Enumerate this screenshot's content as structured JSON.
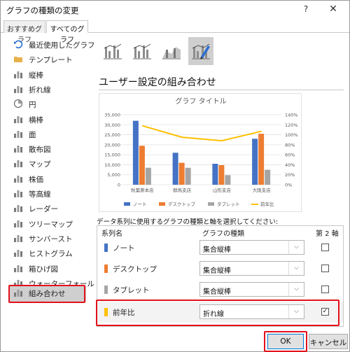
{
  "window": {
    "title": "グラフの種類の変更",
    "help_label": "?",
    "close_label": "✕"
  },
  "tabs": [
    {
      "label": "おすすめグラフ",
      "selected": false
    },
    {
      "label": "すべてのグラフ",
      "selected": true
    }
  ],
  "sidebar": {
    "items": [
      {
        "label": "最近使用したグラフ",
        "icon": "undo-icon"
      },
      {
        "label": "テンプレート",
        "icon": "folder-icon"
      },
      {
        "label": "縦棒",
        "icon": "column-chart-icon"
      },
      {
        "label": "折れ線",
        "icon": "line-chart-icon"
      },
      {
        "label": "円",
        "icon": "pie-chart-icon"
      },
      {
        "label": "横棒",
        "icon": "bar-chart-icon"
      },
      {
        "label": "面",
        "icon": "area-chart-icon"
      },
      {
        "label": "散布図",
        "icon": "scatter-chart-icon"
      },
      {
        "label": "マップ",
        "icon": "map-chart-icon"
      },
      {
        "label": "株価",
        "icon": "stock-chart-icon"
      },
      {
        "label": "等高線",
        "icon": "surface-chart-icon"
      },
      {
        "label": "レーダー",
        "icon": "radar-chart-icon"
      },
      {
        "label": "ツリーマップ",
        "icon": "treemap-chart-icon"
      },
      {
        "label": "サンバースト",
        "icon": "sunburst-chart-icon"
      },
      {
        "label": "ヒストグラム",
        "icon": "histogram-chart-icon"
      },
      {
        "label": "箱ひげ図",
        "icon": "box-whisker-chart-icon"
      },
      {
        "label": "ウォーターフォール",
        "icon": "waterfall-chart-icon"
      },
      {
        "label": "じょうご",
        "icon": "funnel-chart-icon"
      },
      {
        "label": "組み合わせ",
        "icon": "combo-chart-icon",
        "selected": true
      }
    ]
  },
  "subtypes": [
    {
      "icon": "clustered-column-line-icon",
      "selected": false
    },
    {
      "icon": "clustered-column-line-secondary-icon",
      "selected": false
    },
    {
      "icon": "stacked-area-column-icon",
      "selected": false
    },
    {
      "icon": "custom-combo-icon",
      "selected": true
    }
  ],
  "section_title": "ユーザー設定の組み合わせ",
  "chart_data": {
    "type": "bar",
    "title": "グラフ タイトル",
    "categories": [
      "秋葉原本店",
      "群馬支店",
      "山形支店",
      "大阪支店"
    ],
    "series": [
      {
        "name": "ノート",
        "values": [
          32000,
          16000,
          10500,
          23000
        ],
        "color": "#4472c4",
        "kind": "bar"
      },
      {
        "name": "デスクトップ",
        "values": [
          19500,
          11000,
          9800,
          25500
        ],
        "color": "#ed7d31",
        "kind": "bar"
      },
      {
        "name": "タブレット",
        "values": [
          8500,
          8500,
          4800,
          7500
        ],
        "color": "#a5a5a5",
        "kind": "bar"
      },
      {
        "name": "前年比",
        "values": [
          1.18,
          0.95,
          0.88,
          1.07
        ],
        "color": "#ffc000",
        "kind": "line",
        "axis": "secondary"
      }
    ],
    "ylim": [
      0,
      35000
    ],
    "yticks": [
      "0",
      "5,000",
      "10,000",
      "15,000",
      "20,000",
      "25,000",
      "30,000",
      "35,000"
    ],
    "y2lim": [
      0,
      1.4
    ],
    "y2ticks": [
      "0%",
      "20%",
      "40%",
      "60%",
      "80%",
      "100%",
      "120%",
      "140%"
    ],
    "grid": true,
    "legend": "bottom"
  },
  "series_table": {
    "instruction": "データ系列に使用するグラフの種類と軸を選択してください:",
    "headers": {
      "name": "系列名",
      "type": "グラフの種類",
      "secondary": "第 2 軸"
    },
    "dropdown_arrow": "⌵",
    "check_mark": "✓",
    "rows": [
      {
        "name": "ノート",
        "type": "集合縦棒",
        "secondary": false,
        "color": "#4472c4"
      },
      {
        "name": "デスクトップ",
        "type": "集合縦棒",
        "secondary": false,
        "color": "#ed7d31"
      },
      {
        "name": "タブレット",
        "type": "集合縦棒",
        "secondary": false,
        "color": "#a5a5a5"
      },
      {
        "name": "前年比",
        "type": "折れ線",
        "secondary": true,
        "color": "#ffc000"
      }
    ]
  },
  "buttons": {
    "ok": "OK",
    "cancel": "キャンセル"
  }
}
